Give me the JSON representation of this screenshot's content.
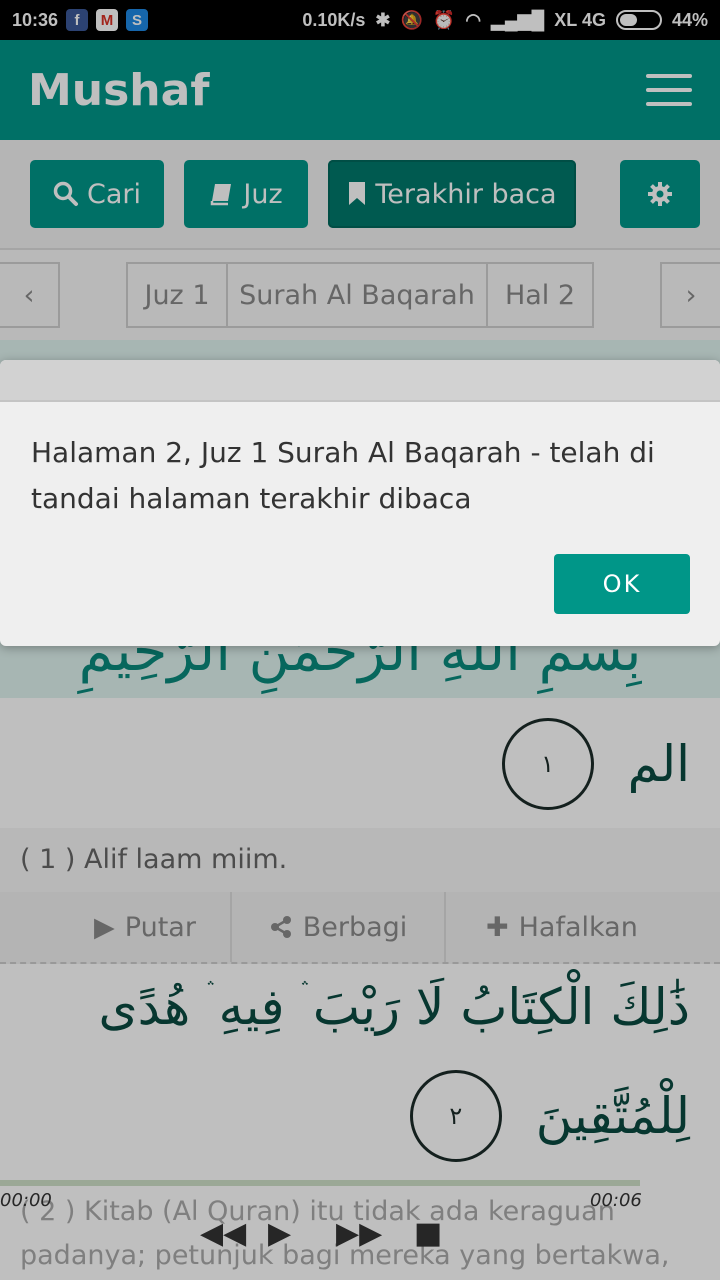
{
  "status_bar": {
    "time": "10:36",
    "apps": [
      "f",
      "M",
      "S"
    ],
    "speed": "0.10K/s",
    "network": "XL 4G",
    "battery": "44%",
    "battery_level": 0.44
  },
  "app": {
    "title": "Mushaf"
  },
  "toolbar": {
    "search_label": "Cari",
    "juz_label": "Juz",
    "last_read_label": "Terakhir baca"
  },
  "pager": {
    "prev": "‹",
    "juz": "Juz 1",
    "surah": "Surah Al Baqarah",
    "page": "Hal 2",
    "next": "›"
  },
  "basmala": "بِسْمِ اللَّهِ الرَّحْمَٰنِ الرَّحِيمِ",
  "ayahs": [
    {
      "arabic": "الم",
      "number": "١",
      "translation": "( 1 ) Alif laam miim."
    },
    {
      "arabic_line1": "ذَٰلِكَ الْكِتَابُ لَا رَيْبَ ۛ فِيهِ ۛ هُدًى",
      "arabic_line2": "لِلْمُتَّقِينَ",
      "number": "٢",
      "translation_line1": "( 2 ) Kitab (Al Quran) itu tidak ada keraguan",
      "translation_line2": "padanya; petunjuk bagi mereka yang bertakwa,"
    }
  ],
  "actions": {
    "play": "Putar",
    "share": "Berbagi",
    "memorize": "Hafalkan"
  },
  "player": {
    "current_time": "00:00",
    "total_time": "00:06"
  },
  "dialog": {
    "message": "Halaman 2, Juz 1 Surah Al Baqarah - telah di tandai halaman terakhir dibaca",
    "ok": "OK"
  }
}
